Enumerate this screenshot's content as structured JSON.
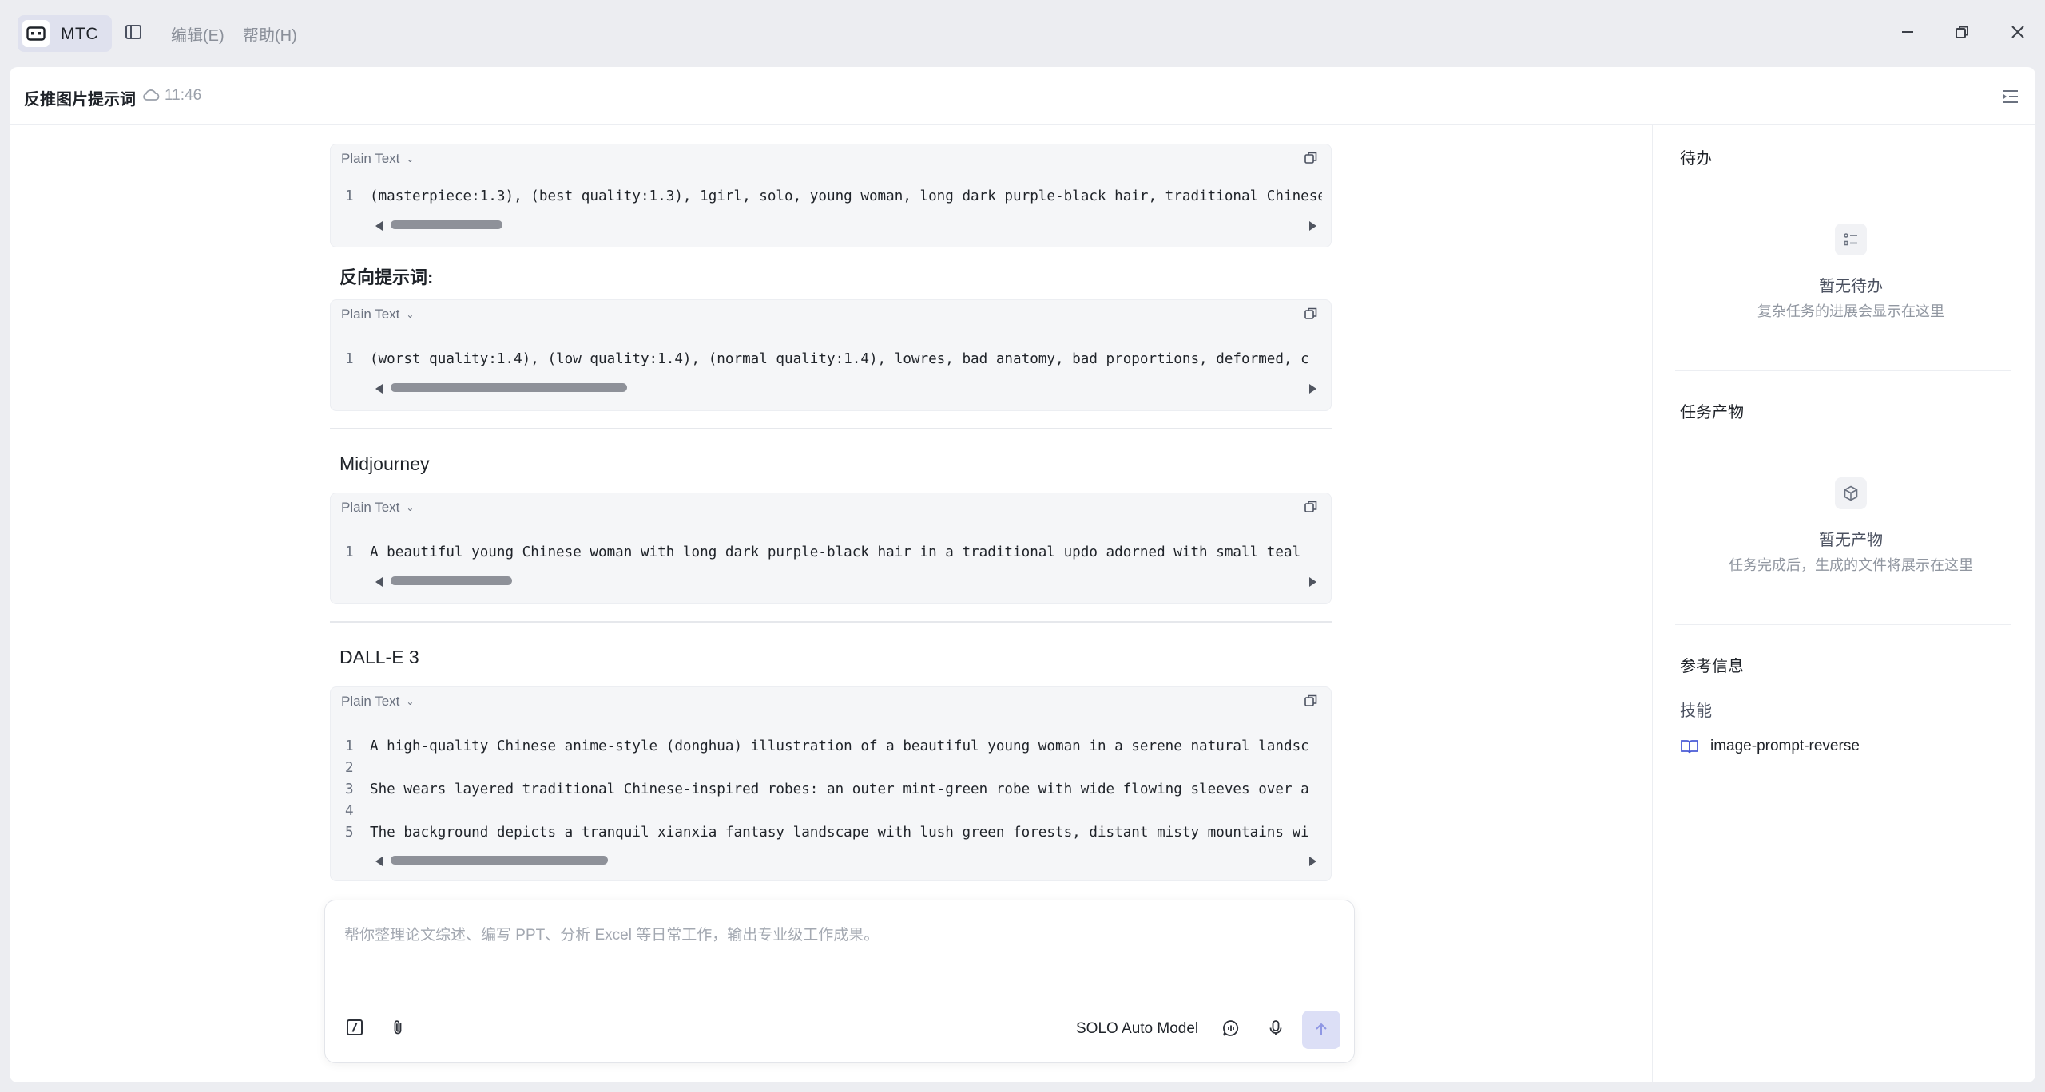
{
  "titlebar": {
    "app_label": "MTC",
    "menu": [
      "编辑(E)",
      "帮助(H)"
    ]
  },
  "header": {
    "title": "反推图片提示词",
    "time": "11:46"
  },
  "content": {
    "blocks": [
      {
        "lang": "Plain Text",
        "lines": [
          "(masterpiece:1.3), (best quality:1.3), 1girl, solo, young woman, long dark purple-black hair, traditional Chinese"
        ],
        "scroll_thumb_fraction": 0.1
      },
      {
        "lang": "Plain Text",
        "lines": [
          "(worst quality:1.4), (low quality:1.4), (normal quality:1.4), lowres, bad anatomy, bad proportions, deformed, c"
        ],
        "scroll_thumb_fraction": 0.3
      },
      {
        "lang": "Plain Text",
        "lines": [
          "A beautiful young Chinese woman with long dark purple-black hair in a traditional updo adorned with small teal"
        ],
        "scroll_thumb_fraction": 0.15
      },
      {
        "lang": "Plain Text",
        "lines": [
          "A high-quality Chinese anime-style (donghua) illustration of a beautiful young woman in a serene natural landsc",
          "",
          "She wears layered traditional Chinese-inspired robes: an outer mint-green robe with wide flowing sleeves over a",
          "",
          "The background depicts a tranquil xianxia fantasy landscape with lush green forests, distant misty mountains wi"
        ],
        "scroll_thumb_fraction": 0.27
      }
    ],
    "negative_label": "反向提示词:",
    "section_midjourney": "Midjourney",
    "section_dalle": "DALL-E 3"
  },
  "composer": {
    "placeholder": "帮你整理论文综述、编写 PPT、分析 Excel 等日常工作，输出专业级工作成果。",
    "model": "SOLO Auto Model"
  },
  "rightbar": {
    "todo_title": "待办",
    "todo_empty": "暂无待办",
    "todo_hint": "复杂任务的进展会显示在这里",
    "artifacts_title": "任务产物",
    "artifacts_empty": "暂无产物",
    "artifacts_hint": "任务完成后，生成的文件将展示在这里",
    "ref_title": "参考信息",
    "skills_label": "技能",
    "skill_name": "image-prompt-reverse"
  },
  "colors": {
    "accent": "#4a5bd6",
    "send_bg": "#dcdff6",
    "code_bg": "#f5f6f8"
  }
}
